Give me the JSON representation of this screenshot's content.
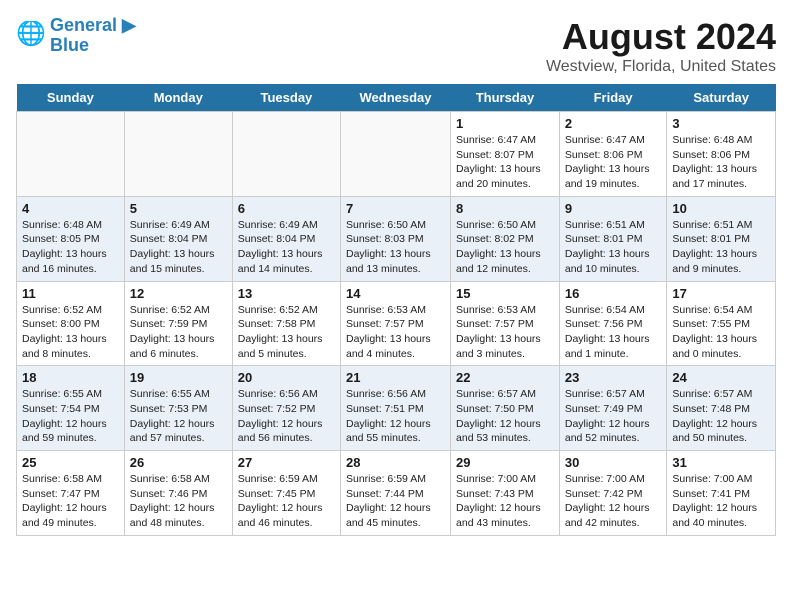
{
  "header": {
    "logo_line1": "General",
    "logo_line2": "Blue",
    "month_year": "August 2024",
    "location": "Westview, Florida, United States"
  },
  "days_of_week": [
    "Sunday",
    "Monday",
    "Tuesday",
    "Wednesday",
    "Thursday",
    "Friday",
    "Saturday"
  ],
  "weeks": [
    [
      {
        "day": "",
        "info": ""
      },
      {
        "day": "",
        "info": ""
      },
      {
        "day": "",
        "info": ""
      },
      {
        "day": "",
        "info": ""
      },
      {
        "day": "1",
        "info": "Sunrise: 6:47 AM\nSunset: 8:07 PM\nDaylight: 13 hours\nand 20 minutes."
      },
      {
        "day": "2",
        "info": "Sunrise: 6:47 AM\nSunset: 8:06 PM\nDaylight: 13 hours\nand 19 minutes."
      },
      {
        "day": "3",
        "info": "Sunrise: 6:48 AM\nSunset: 8:06 PM\nDaylight: 13 hours\nand 17 minutes."
      }
    ],
    [
      {
        "day": "4",
        "info": "Sunrise: 6:48 AM\nSunset: 8:05 PM\nDaylight: 13 hours\nand 16 minutes."
      },
      {
        "day": "5",
        "info": "Sunrise: 6:49 AM\nSunset: 8:04 PM\nDaylight: 13 hours\nand 15 minutes."
      },
      {
        "day": "6",
        "info": "Sunrise: 6:49 AM\nSunset: 8:04 PM\nDaylight: 13 hours\nand 14 minutes."
      },
      {
        "day": "7",
        "info": "Sunrise: 6:50 AM\nSunset: 8:03 PM\nDaylight: 13 hours\nand 13 minutes."
      },
      {
        "day": "8",
        "info": "Sunrise: 6:50 AM\nSunset: 8:02 PM\nDaylight: 13 hours\nand 12 minutes."
      },
      {
        "day": "9",
        "info": "Sunrise: 6:51 AM\nSunset: 8:01 PM\nDaylight: 13 hours\nand 10 minutes."
      },
      {
        "day": "10",
        "info": "Sunrise: 6:51 AM\nSunset: 8:01 PM\nDaylight: 13 hours\nand 9 minutes."
      }
    ],
    [
      {
        "day": "11",
        "info": "Sunrise: 6:52 AM\nSunset: 8:00 PM\nDaylight: 13 hours\nand 8 minutes."
      },
      {
        "day": "12",
        "info": "Sunrise: 6:52 AM\nSunset: 7:59 PM\nDaylight: 13 hours\nand 6 minutes."
      },
      {
        "day": "13",
        "info": "Sunrise: 6:52 AM\nSunset: 7:58 PM\nDaylight: 13 hours\nand 5 minutes."
      },
      {
        "day": "14",
        "info": "Sunrise: 6:53 AM\nSunset: 7:57 PM\nDaylight: 13 hours\nand 4 minutes."
      },
      {
        "day": "15",
        "info": "Sunrise: 6:53 AM\nSunset: 7:57 PM\nDaylight: 13 hours\nand 3 minutes."
      },
      {
        "day": "16",
        "info": "Sunrise: 6:54 AM\nSunset: 7:56 PM\nDaylight: 13 hours\nand 1 minute."
      },
      {
        "day": "17",
        "info": "Sunrise: 6:54 AM\nSunset: 7:55 PM\nDaylight: 13 hours\nand 0 minutes."
      }
    ],
    [
      {
        "day": "18",
        "info": "Sunrise: 6:55 AM\nSunset: 7:54 PM\nDaylight: 12 hours\nand 59 minutes."
      },
      {
        "day": "19",
        "info": "Sunrise: 6:55 AM\nSunset: 7:53 PM\nDaylight: 12 hours\nand 57 minutes."
      },
      {
        "day": "20",
        "info": "Sunrise: 6:56 AM\nSunset: 7:52 PM\nDaylight: 12 hours\nand 56 minutes."
      },
      {
        "day": "21",
        "info": "Sunrise: 6:56 AM\nSunset: 7:51 PM\nDaylight: 12 hours\nand 55 minutes."
      },
      {
        "day": "22",
        "info": "Sunrise: 6:57 AM\nSunset: 7:50 PM\nDaylight: 12 hours\nand 53 minutes."
      },
      {
        "day": "23",
        "info": "Sunrise: 6:57 AM\nSunset: 7:49 PM\nDaylight: 12 hours\nand 52 minutes."
      },
      {
        "day": "24",
        "info": "Sunrise: 6:57 AM\nSunset: 7:48 PM\nDaylight: 12 hours\nand 50 minutes."
      }
    ],
    [
      {
        "day": "25",
        "info": "Sunrise: 6:58 AM\nSunset: 7:47 PM\nDaylight: 12 hours\nand 49 minutes."
      },
      {
        "day": "26",
        "info": "Sunrise: 6:58 AM\nSunset: 7:46 PM\nDaylight: 12 hours\nand 48 minutes."
      },
      {
        "day": "27",
        "info": "Sunrise: 6:59 AM\nSunset: 7:45 PM\nDaylight: 12 hours\nand 46 minutes."
      },
      {
        "day": "28",
        "info": "Sunrise: 6:59 AM\nSunset: 7:44 PM\nDaylight: 12 hours\nand 45 minutes."
      },
      {
        "day": "29",
        "info": "Sunrise: 7:00 AM\nSunset: 7:43 PM\nDaylight: 12 hours\nand 43 minutes."
      },
      {
        "day": "30",
        "info": "Sunrise: 7:00 AM\nSunset: 7:42 PM\nDaylight: 12 hours\nand 42 minutes."
      },
      {
        "day": "31",
        "info": "Sunrise: 7:00 AM\nSunset: 7:41 PM\nDaylight: 12 hours\nand 40 minutes."
      }
    ]
  ]
}
